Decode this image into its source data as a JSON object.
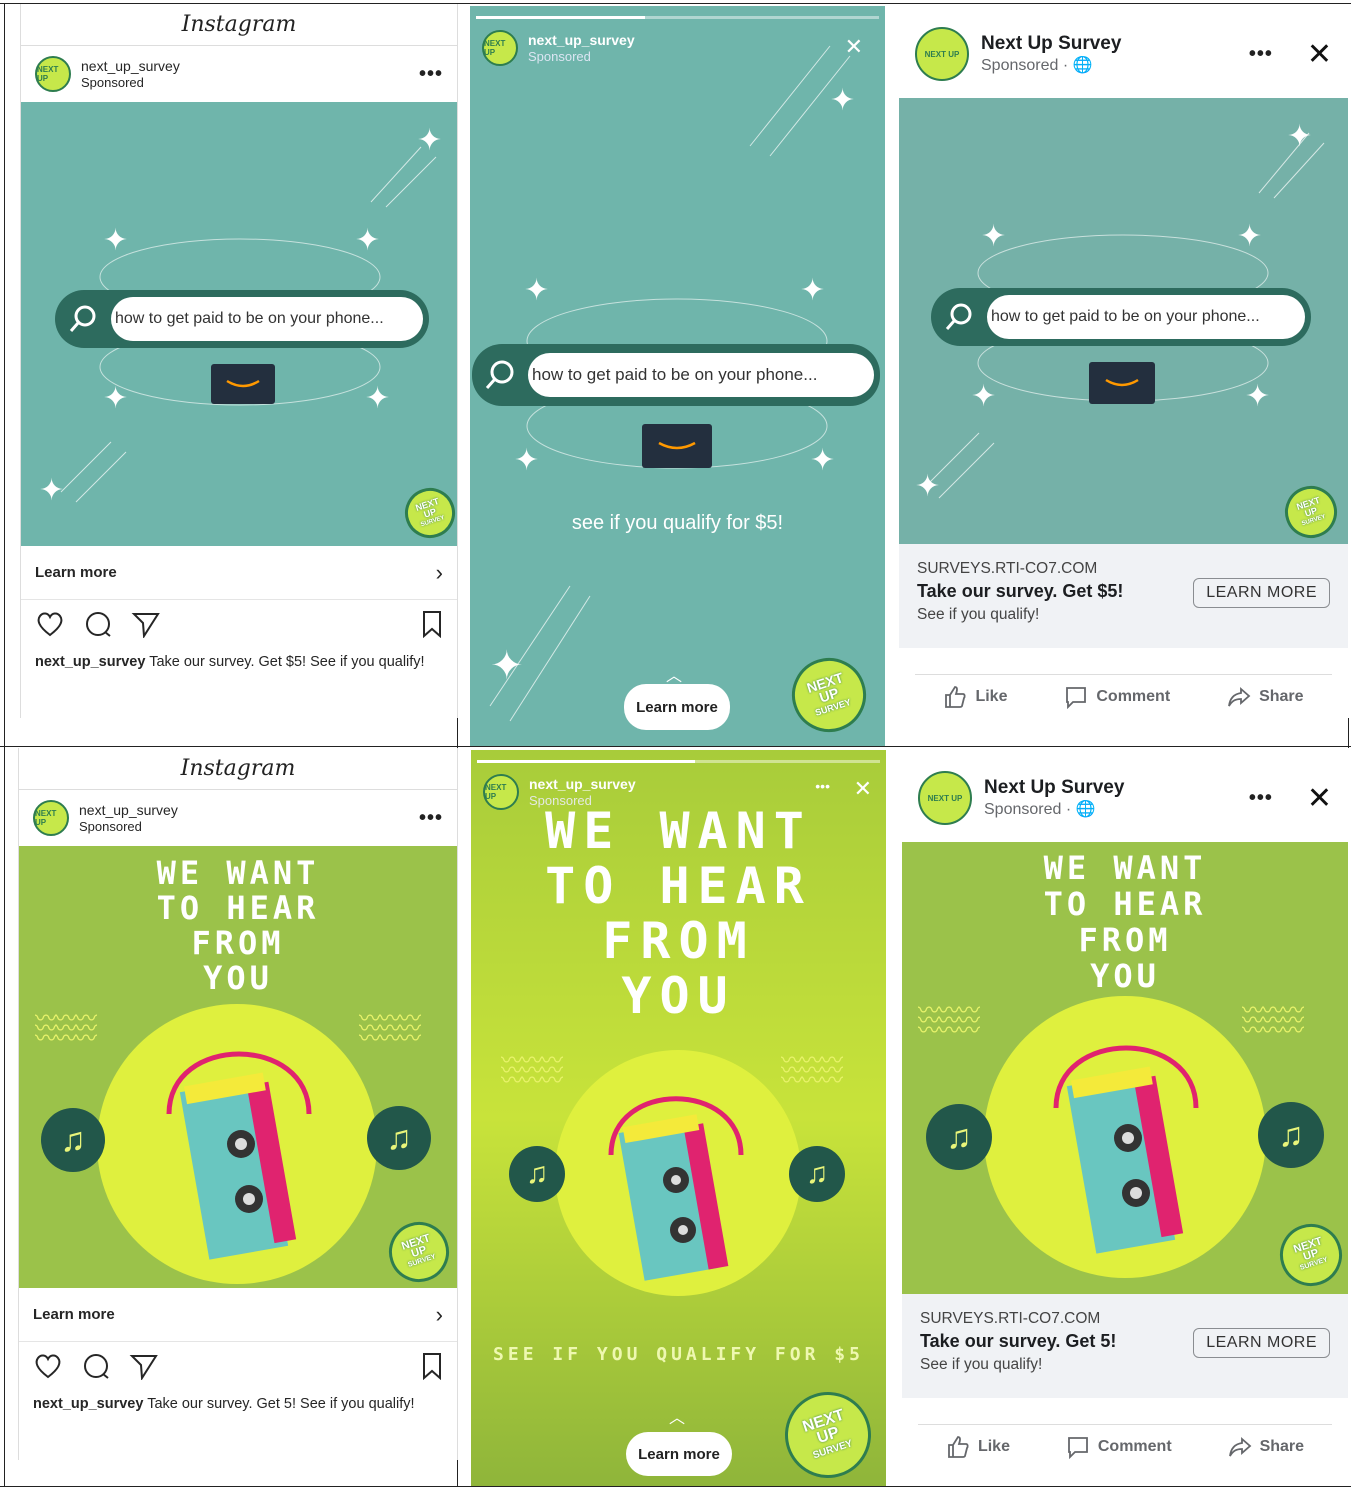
{
  "instagram": {
    "app_title": "Instagram",
    "username": "next_up_survey",
    "sponsored": "Sponsored",
    "learn_more": "Learn more",
    "caption_text_1": "Take our survey. Get $5! See if you qualify!",
    "caption_text_2": "Take our survey. Get 5! See if you qualify!"
  },
  "ad_teal": {
    "search_text": "how to get paid to be on your phone...",
    "story_text": "see if you qualify for $5!"
  },
  "ad_green": {
    "headline_lines": [
      "WE WANT",
      "TO HEAR",
      "FROM",
      "YOU"
    ],
    "story_text": "SEE IF YOU QUALIFY FOR $5"
  },
  "badge": {
    "line1": "NEXT",
    "line2": "UP",
    "line3": "SURVEY"
  },
  "story": {
    "username": "next_up_survey",
    "sponsored": "Sponsored",
    "learn_more": "Learn more",
    "dots": "•••"
  },
  "facebook": {
    "page_name": "Next Up Survey",
    "sponsored": "Sponsored · ",
    "link_url": "SURVEYS.RTI-CO7.COM",
    "link_title_1": "Take our survey. Get $5!",
    "link_title_2": "Take our survey. Get 5!",
    "link_desc": "See if you qualify!",
    "learn_more_btn": "LEARN MORE",
    "like": "Like",
    "comment": "Comment",
    "share": "Share"
  },
  "colors": {
    "teal_bg": "#6fb5ab",
    "green_bg": "#9bc24a",
    "dark_green": "#2d6b5e",
    "lime": "#dff03e"
  }
}
